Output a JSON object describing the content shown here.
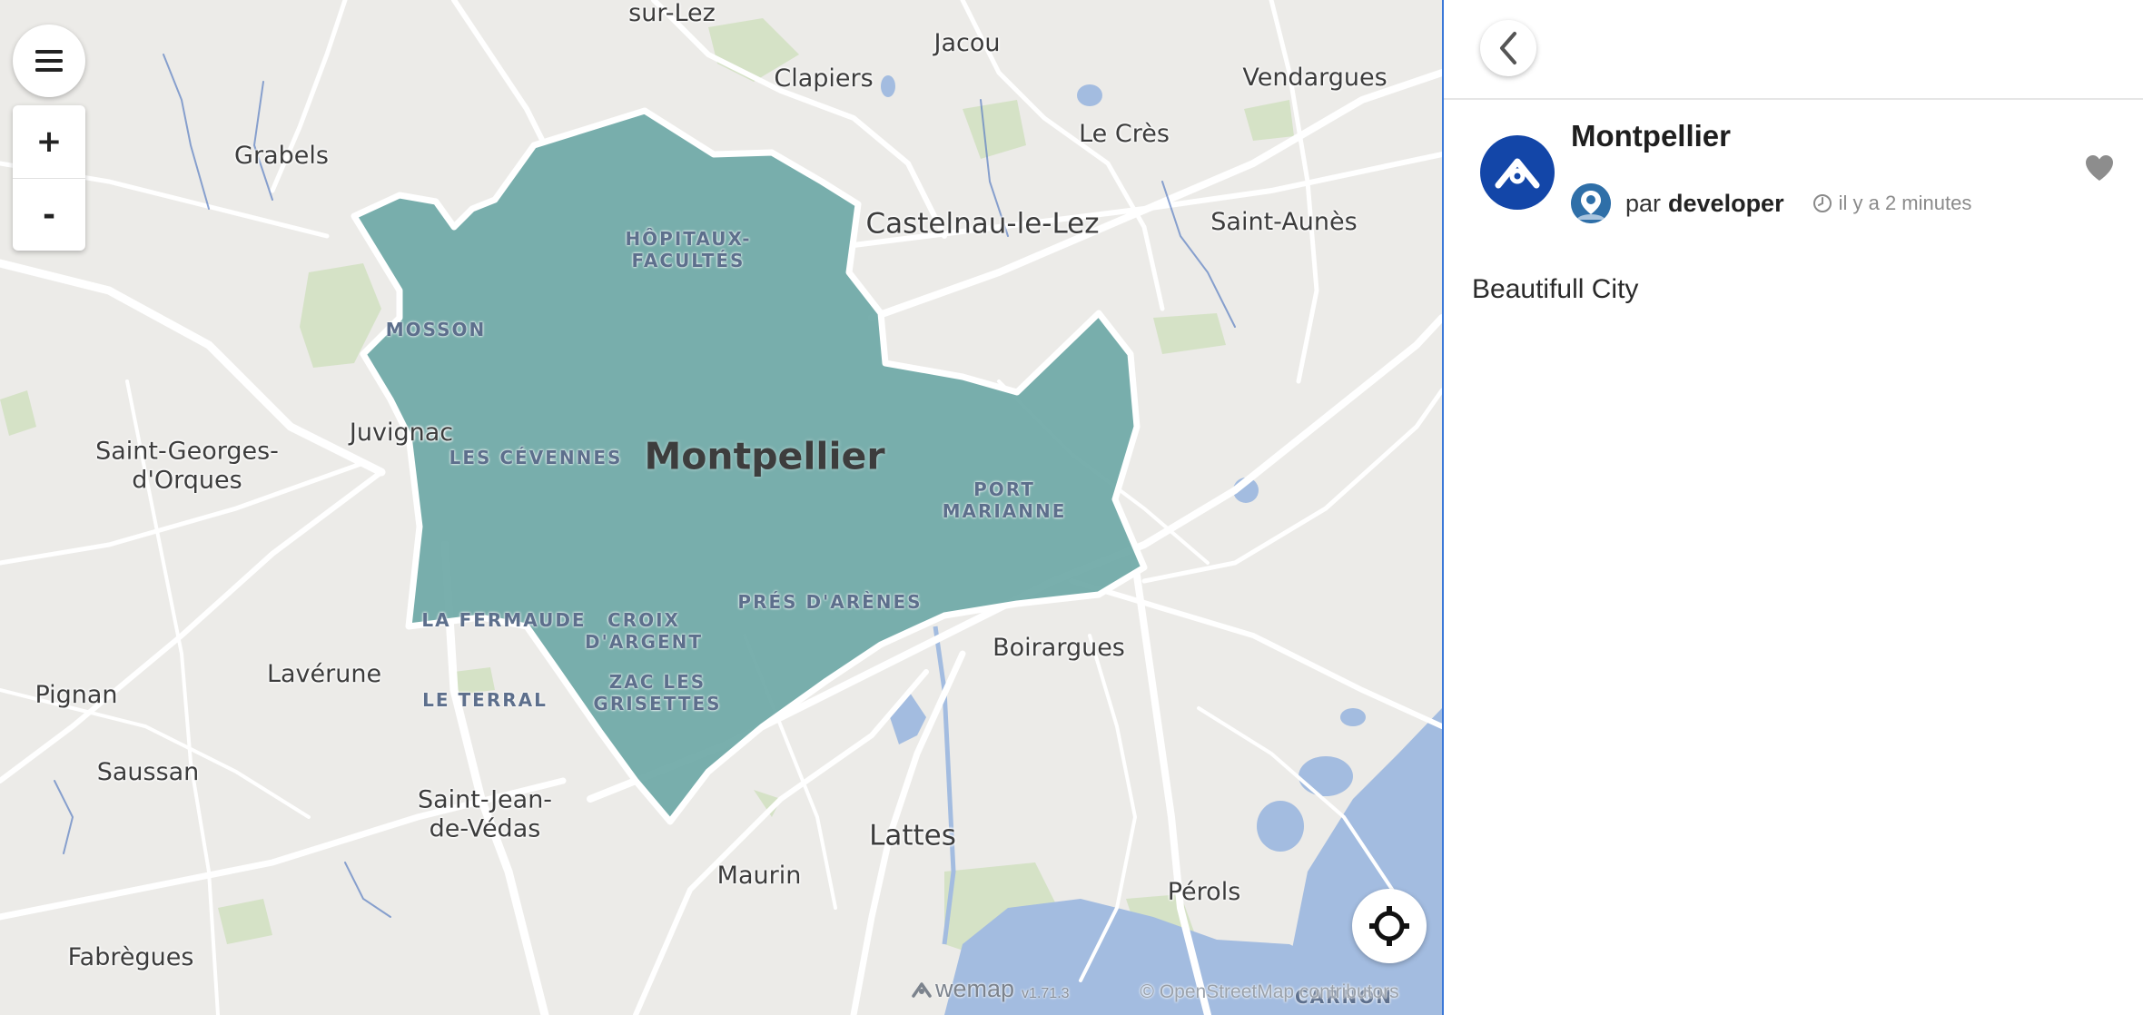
{
  "map": {
    "places": {
      "sur_lez": "sur-Lez",
      "jacou": "Jacou",
      "clapiers": "Clapiers",
      "vendargues": "Vendargues",
      "grabels": "Grabels",
      "le_cres": "Le Crès",
      "castelnau": "Castelnau-le-Lez",
      "saint_aunes": "Saint-Aunès",
      "juvignac": "Juvignac",
      "saint_georges": "Saint-Georges-\nd'Orques",
      "boirargues": "Boirargues",
      "laverune": "Lavérune",
      "pignan": "Pignan",
      "saussan": "Saussan",
      "saint_jean": "Saint-Jean-\nde-Védas",
      "lattes": "Lattes",
      "maurin": "Maurin",
      "perols": "Pérols",
      "fabregues": "Fabrègues"
    },
    "city_label": "Montpellier",
    "neighborhoods": {
      "hopitaux": "HÔPITAUX-\nFACULTÉS",
      "mosson": "MOSSON",
      "cevennes": "LES CÉVENNES",
      "port_marianne": "PORT\nMARIANNE",
      "fermaude": "LA FERMAUDE",
      "croix_argent": "CROIX\nD'ARGENT",
      "pres_arenes": "PRÉS D'ARÈNES",
      "zac_grisettes": "ZAC LES\nGRISETTES",
      "terral": "LE TERRAL",
      "carnon": "CARNON"
    },
    "controls": {
      "zoom_in": "+",
      "zoom_out": "-"
    },
    "attribution": {
      "brand": "wemap",
      "version": "v1.71.3",
      "osm": "© OpenStreetMap contributors"
    },
    "colors": {
      "land": "#ecebe8",
      "water": "#a3bce0",
      "green": "#d5e2c6",
      "road": "#ffffff",
      "area_fill": "#6ea8a6"
    }
  },
  "panel": {
    "pin_title": "Montpellier",
    "author_prefix": "par",
    "author_name": "developer",
    "time_ago": "il y a 2 minutes",
    "description": "Beautifull City",
    "colors": {
      "logo": "#1346a8",
      "divider": "#3b78d8"
    }
  }
}
